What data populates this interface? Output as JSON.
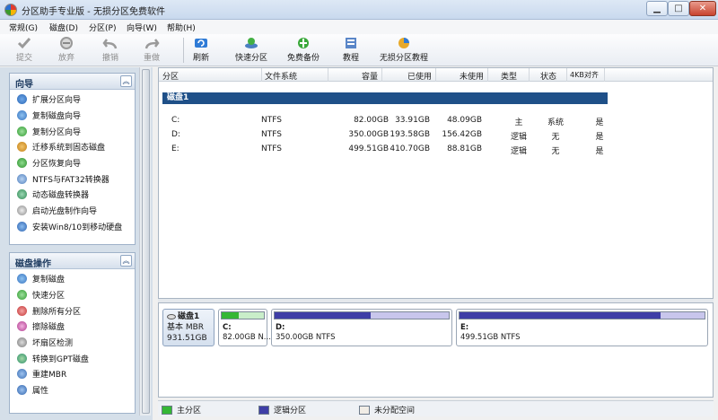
{
  "window": {
    "title": "分区助手专业版 - 无损分区免费软件"
  },
  "menu": [
    "常规(G)",
    "磁盘(D)",
    "分区(P)",
    "向导(W)",
    "帮助(H)"
  ],
  "toolbar": {
    "submit": "提交",
    "discard": "放弃",
    "undo": "撤销",
    "redo": "重做",
    "refresh": "刷新",
    "quick_partition": "快速分区",
    "free_backup": "免费备份",
    "tutorial": "教程",
    "lossless_tutorial": "无损分区教程"
  },
  "wizard": {
    "title": "向导",
    "items": [
      "扩展分区向导",
      "复制磁盘向导",
      "复制分区向导",
      "迁移系统到固态磁盘",
      "分区恢复向导",
      "NTFS与FAT32转换器",
      "动态磁盘转换器",
      "启动光盘制作向导",
      "安装Win8/10到移动硬盘"
    ]
  },
  "disk_ops": {
    "title": "磁盘操作",
    "items": [
      "复制磁盘",
      "快速分区",
      "删除所有分区",
      "擦除磁盘",
      "坏扇区检测",
      "转换到GPT磁盘",
      "重建MBR",
      "属性"
    ]
  },
  "table": {
    "headers": [
      "分区",
      "文件系统",
      "容量",
      "已使用",
      "未使用",
      "类型",
      "状态",
      "4KB对齐"
    ],
    "disk_label": "磁盘1",
    "rows": [
      [
        "C:",
        "NTFS",
        "82.00GB",
        "33.91GB",
        "48.09GB",
        "主",
        "系统",
        "是"
      ],
      [
        "D:",
        "NTFS",
        "350.00GB",
        "193.58GB",
        "156.42GB",
        "逻辑",
        "无",
        "是"
      ],
      [
        "E:",
        "NTFS",
        "499.51GB",
        "410.70GB",
        "88.81GB",
        "逻辑",
        "无",
        "是"
      ]
    ]
  },
  "diskmap": {
    "disk_name": "磁盘1",
    "disk_type": "基本 MBR",
    "disk_size": "931.51GB",
    "partitions": [
      {
        "name": "C:",
        "detail": "82.00GB N...",
        "used_fraction": 0.41,
        "color": "#35b735"
      },
      {
        "name": "D:",
        "detail": "350.00GB NTFS",
        "used_fraction": 0.55,
        "color": "#3e3ea6"
      },
      {
        "name": "E:",
        "detail": "499.51GB NTFS",
        "used_fraction": 0.82,
        "color": "#3e3ea6"
      }
    ]
  },
  "legend": {
    "primary": "主分区",
    "logical": "逻辑分区",
    "unallocated": "未分配空间"
  },
  "colors": {
    "primary": "#35b735",
    "logical": "#3e3ea6",
    "unallocated": "#f1ede6",
    "disk_bar": "#1f5088"
  }
}
